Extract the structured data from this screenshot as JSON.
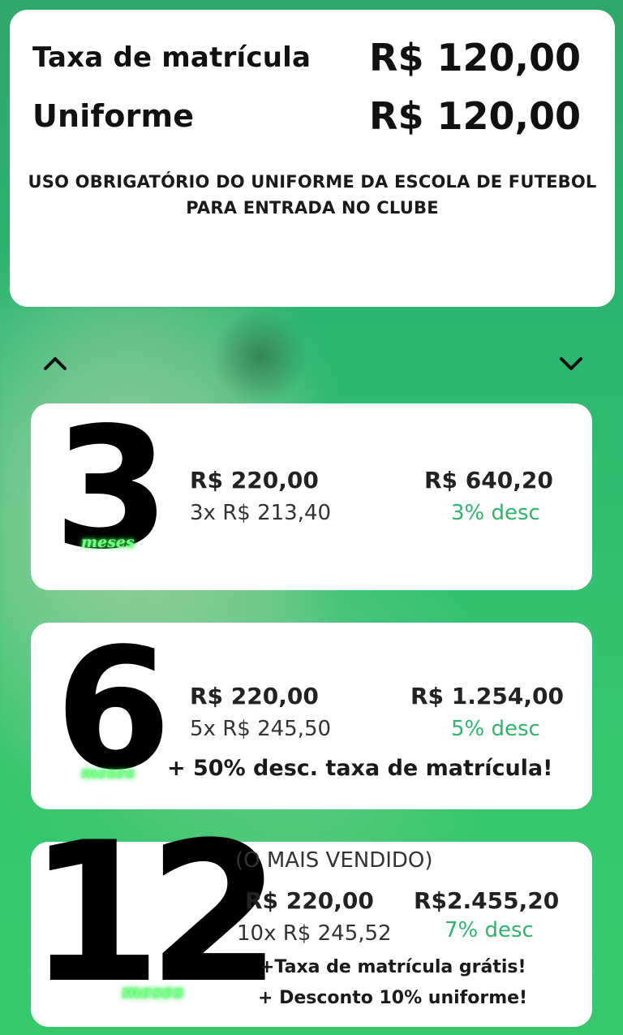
{
  "fees": {
    "enrollment_label": "Taxa de matrícula",
    "enrollment_value": "R$ 120,00",
    "uniform_label": "Uniforme",
    "uniform_value": "R$ 120,00",
    "notice_line1": "USO OBRIGATÓRIO DO UNIFORME DA ESCOLA DE FUTEBOL",
    "notice_line2": "PARA ENTRADA NO CLUBE"
  },
  "nav": {
    "up_icon": "chevron-up-icon",
    "down_icon": "chevron-down-icon"
  },
  "plans": [
    {
      "months": "3",
      "unit": "meses",
      "monthly_price": "R$ 220,00",
      "installments": "3x R$ 213,40",
      "total": "R$ 640,20",
      "discount": "3% desc"
    },
    {
      "months": "6",
      "unit": "meses",
      "monthly_price": "R$ 220,00",
      "installments": "5x R$ 245,50",
      "total": "R$ 1.254,00",
      "discount": "5% desc",
      "extra": "+ 50% desc. taxa de matrícula!"
    },
    {
      "months": "12",
      "unit": "meses",
      "tag": "(O MAIS VENDIDO)",
      "monthly_price": "R$ 220,00",
      "installments": "10x R$ 245,52",
      "total": "R$2.455,20",
      "discount": "7% desc",
      "extra1": "+Taxa de matrícula grátis!",
      "extra2": "+ Desconto 10% uniforme!"
    }
  ],
  "colors": {
    "background": "#33c070",
    "card": "#ffffff",
    "discount": "#2eb56a",
    "meses_glow": "#7dff8a"
  }
}
